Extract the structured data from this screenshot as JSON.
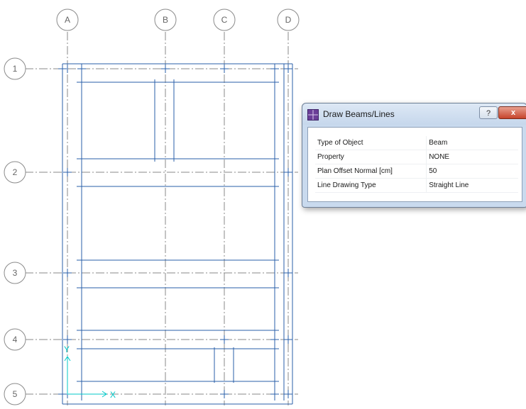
{
  "plan": {
    "column_grid_labels": [
      "A",
      "B",
      "C",
      "D"
    ],
    "row_grid_labels": [
      "1",
      "2",
      "3",
      "4",
      "5"
    ],
    "axis_x_label": "X",
    "axis_y_label": "Y",
    "colors": {
      "beam_line": "#2a5fa8",
      "grid_line": "#8a8a8a",
      "grid_bubble": "#8a8a8a",
      "axis": "#00c8c8"
    }
  },
  "dialog": {
    "title": "Draw Beams/Lines",
    "help_button": "?",
    "close_button": "x",
    "properties": [
      {
        "label": "Type of Object",
        "value": "Beam"
      },
      {
        "label": "Property",
        "value": "NONE"
      },
      {
        "label": "Plan Offset Normal  [cm]",
        "value": "50"
      },
      {
        "label": "Line Drawing Type",
        "value": "Straight Line"
      }
    ]
  }
}
